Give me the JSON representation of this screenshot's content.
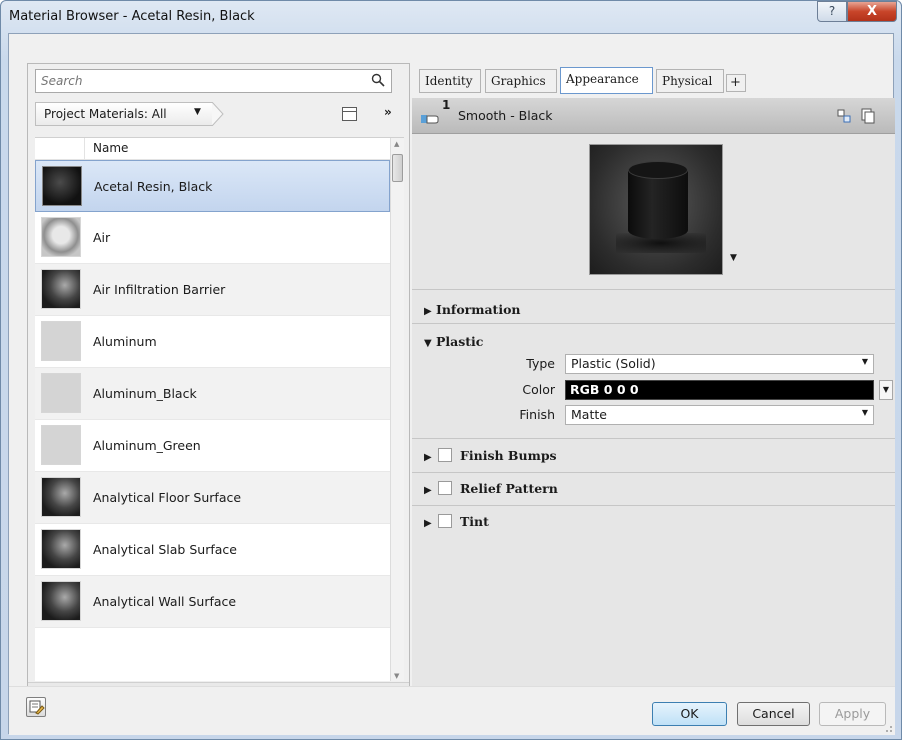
{
  "window": {
    "title": "Material Browser - Acetal Resin, Black",
    "help_glyph": "?",
    "close_glyph": "X"
  },
  "browser": {
    "search_placeholder": "Search",
    "filter_label": "Project Materials: All",
    "column_name": "Name",
    "materials": [
      {
        "name": "Acetal Resin, Black",
        "thumb": "black",
        "selected": true
      },
      {
        "name": "Air",
        "thumb": "air",
        "selected": false
      },
      {
        "name": "Air Infiltration Barrier",
        "thumb": "sphere",
        "selected": false
      },
      {
        "name": "Aluminum",
        "thumb": "gray",
        "selected": false
      },
      {
        "name": "Aluminum_Black",
        "thumb": "gray",
        "selected": false
      },
      {
        "name": "Aluminum_Green",
        "thumb": "gray",
        "selected": false
      },
      {
        "name": "Analytical Floor Surface",
        "thumb": "sphere",
        "selected": false
      },
      {
        "name": "Analytical Slab Surface",
        "thumb": "sphere",
        "selected": false
      },
      {
        "name": "Analytical Wall Surface",
        "thumb": "sphere",
        "selected": false
      }
    ]
  },
  "editor": {
    "tabs": [
      "Identity",
      "Graphics",
      "Appearance",
      "Physical",
      "+"
    ],
    "active_tab": "Appearance",
    "asset": {
      "count": "1",
      "name": "Smooth - Black"
    },
    "sections": {
      "information": "Information",
      "plastic": "Plastic",
      "finish_bumps": "Finish Bumps",
      "relief_pattern": "Relief Pattern",
      "tint": "Tint"
    },
    "plastic": {
      "type_label": "Type",
      "type_value": "Plastic (Solid)",
      "color_label": "Color",
      "color_value": "RGB 0 0 0",
      "finish_label": "Finish",
      "finish_value": "Matte"
    }
  },
  "footer": {
    "ok": "OK",
    "cancel": "Cancel",
    "apply": "Apply"
  },
  "colors": {
    "selection": "#c3d5ee",
    "ok_button": "#bfe1f7",
    "close_button": "#c8452a"
  }
}
